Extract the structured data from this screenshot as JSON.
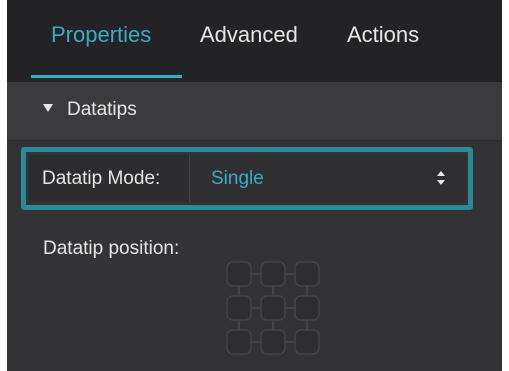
{
  "tabs": [
    {
      "label": "Properties",
      "active": true
    },
    {
      "label": "Advanced",
      "active": false
    },
    {
      "label": "Actions",
      "active": false
    }
  ],
  "section": {
    "title": "Datatips",
    "expanded": true
  },
  "datatip_mode": {
    "label": "Datatip Mode:",
    "value": "Single"
  },
  "datatip_position": {
    "label": "Datatip position:"
  },
  "colors": {
    "accent": "#35aec5",
    "highlight_border": "#2a8a9c",
    "panel_bg": "#333335",
    "tabbar_bg": "#232325"
  },
  "icons": {
    "section_toggle": "triangle-down-icon",
    "select_arrows": "up-down-arrows-icon",
    "position_grid": "position-grid-icon"
  }
}
